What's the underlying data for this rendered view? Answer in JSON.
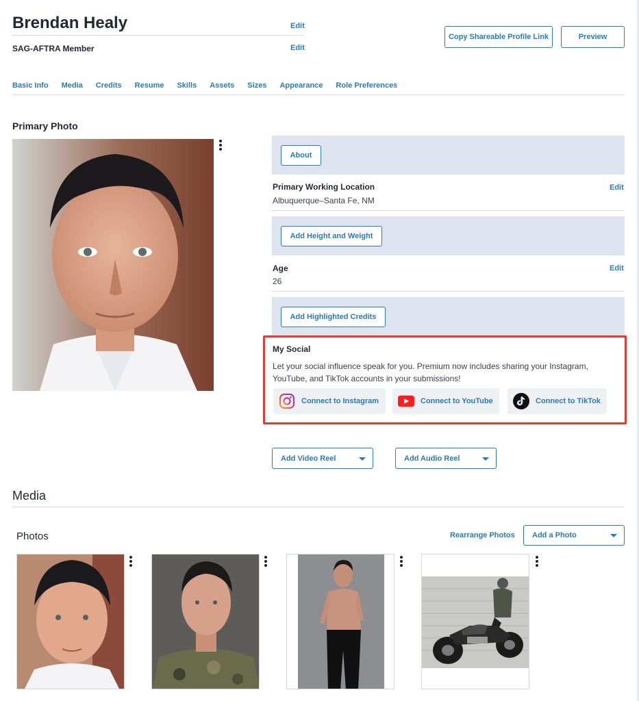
{
  "profile": {
    "name": "Brendan Healy",
    "member": "SAG-AFTRA Member",
    "edit_label": "Edit"
  },
  "header_actions": {
    "copy_link": "Copy Shareable Profile Link",
    "preview": "Preview"
  },
  "tabs": [
    "Basic Info",
    "Media",
    "Credits",
    "Resume",
    "Skills",
    "Assets",
    "Sizes",
    "Appearance",
    "Role Preferences"
  ],
  "primary_photo": {
    "title": "Primary Photo"
  },
  "about": {
    "button": "About"
  },
  "location": {
    "label": "Primary Working Location",
    "value": "Albuquerque–Santa Fe, NM",
    "edit": "Edit"
  },
  "height_weight": {
    "button": "Add Height and Weight"
  },
  "age": {
    "label": "Age",
    "value": "26",
    "edit": "Edit"
  },
  "credits": {
    "button": "Add Highlighted Credits"
  },
  "social": {
    "title": "My Social",
    "description": "Let your social influence speak for you. Premium now includes sharing your Instagram, YouTube, and TikTok accounts in your submissions!",
    "instagram": "Connect to Instagram",
    "youtube": "Connect to YouTube",
    "tiktok": "Connect to TikTok"
  },
  "reels": {
    "video": "Add Video Reel",
    "audio": "Add Audio Reel"
  },
  "media": {
    "title": "Media",
    "photos_title": "Photos",
    "rearrange": "Rearrange Photos",
    "add_photo": "Add a Photo"
  },
  "colors": {
    "accent": "#2a7ab8",
    "panel": "#dee4ef",
    "highlight": "#e63a2e"
  },
  "icons": [
    "more-vertical-icon",
    "instagram-icon",
    "youtube-icon",
    "tiktok-icon",
    "caret-down-icon"
  ]
}
